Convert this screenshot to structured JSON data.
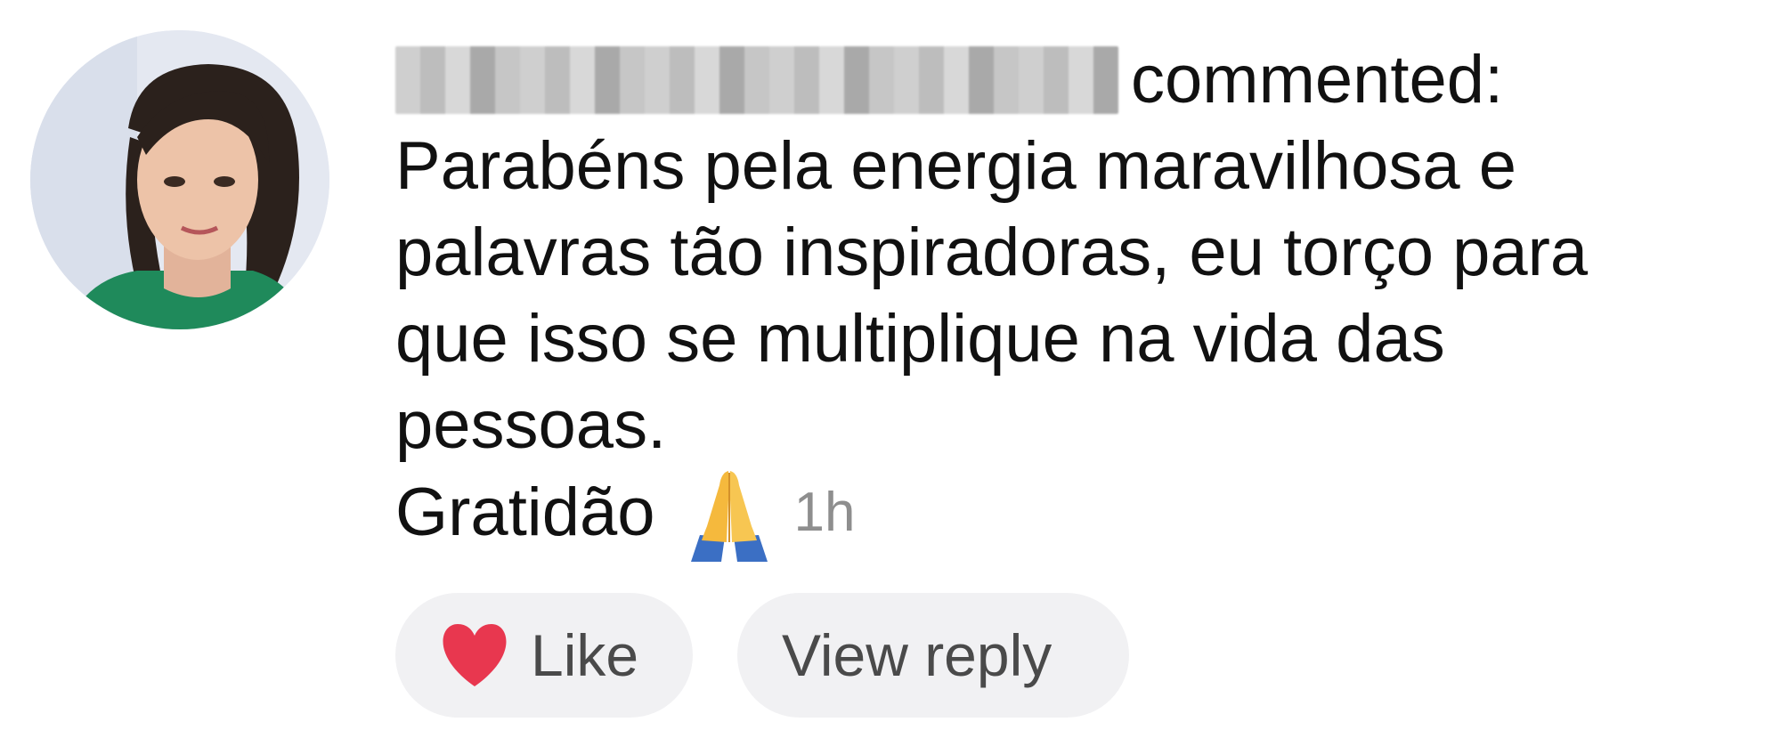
{
  "comment": {
    "commented_label": "commented:",
    "body": "Parabéns pela energia maravilhosa e\npalavras tão inspiradoras, eu torço para\nque isso se multiplique na vida das\npessoas.",
    "gratitude": "Gratidão",
    "emoji": "folded-hands-icon",
    "timestamp": "1h"
  },
  "actions": {
    "like_label": "Like",
    "reply_label": "View reply"
  },
  "colors": {
    "heart": "#e8374f",
    "pill_background": "#f1f1f3",
    "timestamp": "#8e8e8e",
    "text": "#111111"
  }
}
